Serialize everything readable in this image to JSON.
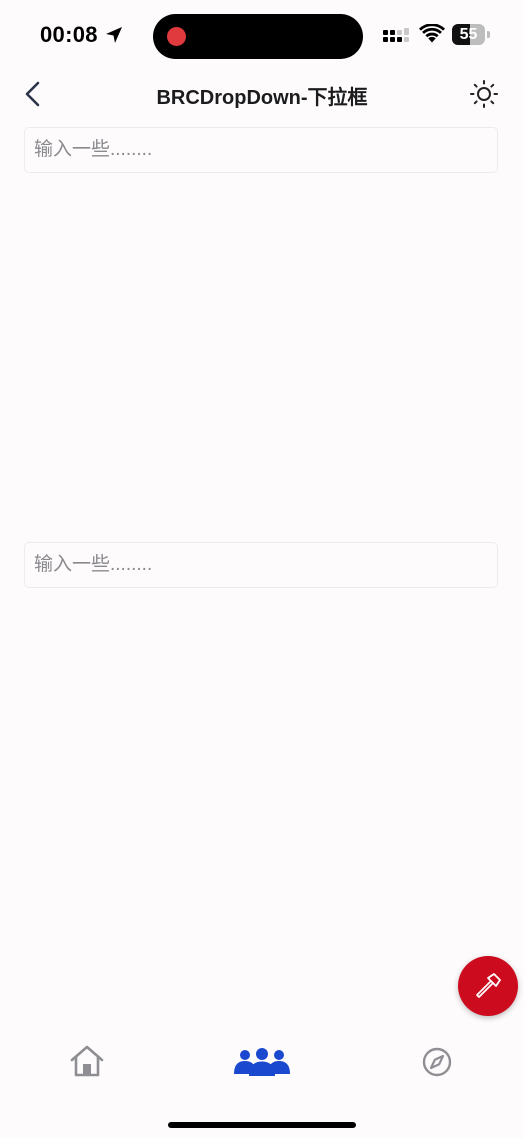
{
  "status_bar": {
    "time": "00:08",
    "battery_level": "55",
    "battery_fraction": 0.55,
    "recording_indicator_color": "#e03a3e"
  },
  "nav": {
    "title": "BRCDropDown-下拉框",
    "back_icon": "chevron-left-icon",
    "right_icon": "sun-icon"
  },
  "inputs": [
    {
      "value": "",
      "placeholder": "输入一些........"
    },
    {
      "value": "",
      "placeholder": "输入一些........"
    }
  ],
  "fab": {
    "icon": "hammer-icon",
    "color": "#cc0b1f"
  },
  "tab_bar": {
    "active_color": "#1a49d0",
    "inactive_color": "#8e8e93",
    "items": [
      {
        "icon": "home-icon",
        "active": false
      },
      {
        "icon": "people-icon",
        "active": true
      },
      {
        "icon": "compass-icon",
        "active": false
      }
    ]
  }
}
